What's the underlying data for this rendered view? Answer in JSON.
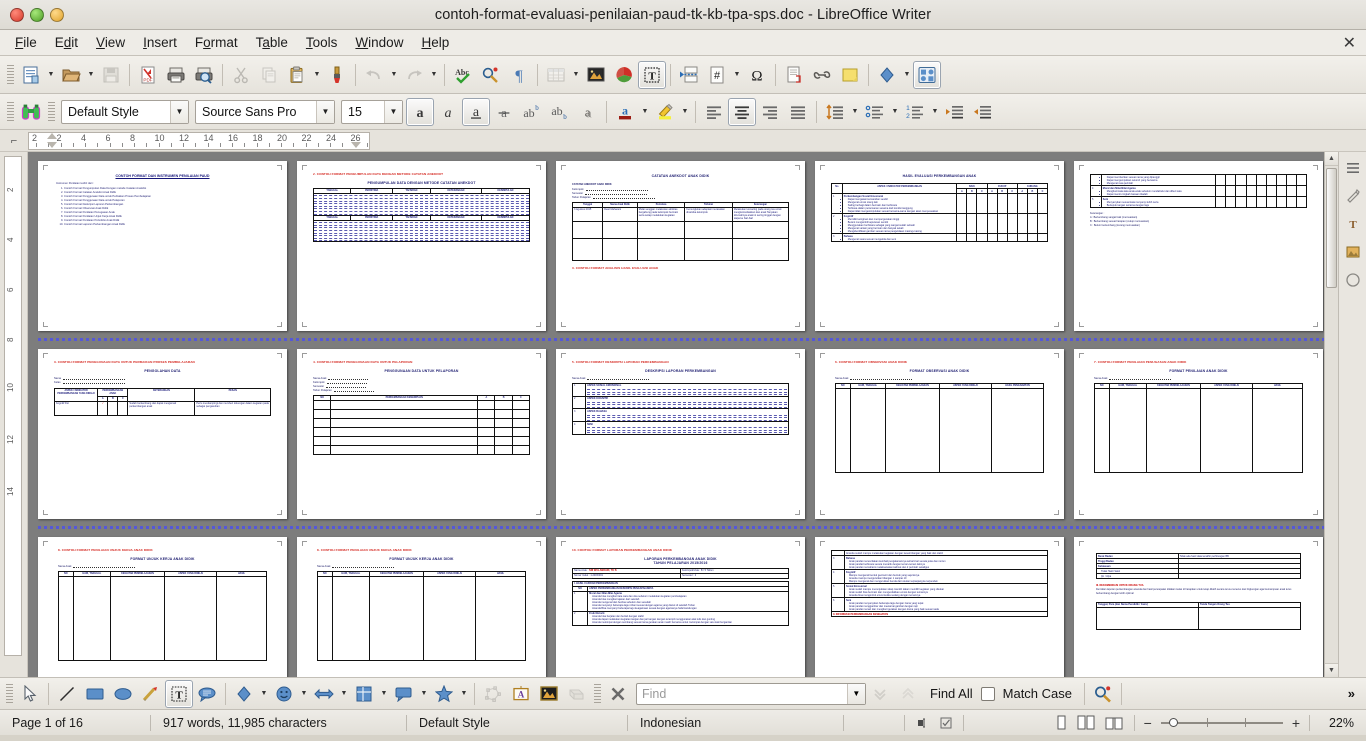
{
  "window": {
    "title": "contoh-format-evaluasi-penilaian-paud-tk-kb-tpa-sps.doc  -  LibreOffice Writer",
    "close_doc_glyph": "✕"
  },
  "menu": {
    "items": [
      {
        "label": "File"
      },
      {
        "label": "Edit"
      },
      {
        "label": "View"
      },
      {
        "label": "Insert"
      },
      {
        "label": "Format"
      },
      {
        "label": "Table"
      },
      {
        "label": "Tools"
      },
      {
        "label": "Window"
      },
      {
        "label": "Help"
      }
    ]
  },
  "standard_toolbar": {
    "buttons": [
      {
        "name": "new-document",
        "label": "New"
      },
      {
        "name": "open-document",
        "label": "Open"
      },
      {
        "name": "save-document",
        "label": "Save"
      },
      {
        "name": "export-pdf",
        "label": "Export as PDF"
      },
      {
        "name": "print-document",
        "label": "Print"
      },
      {
        "name": "print-preview",
        "label": "Print Preview"
      },
      {
        "name": "cut",
        "label": "Cut"
      },
      {
        "name": "copy",
        "label": "Copy"
      },
      {
        "name": "paste",
        "label": "Paste"
      },
      {
        "name": "clone-formatting",
        "label": "Clone Formatting"
      },
      {
        "name": "undo",
        "label": "Undo"
      },
      {
        "name": "redo",
        "label": "Redo"
      },
      {
        "name": "spelling",
        "label": "Spelling"
      },
      {
        "name": "auto-spellcheck",
        "label": "Auto Spellcheck"
      },
      {
        "name": "formatting-marks",
        "label": "Formatting Marks"
      },
      {
        "name": "insert-table",
        "label": "Insert Table"
      },
      {
        "name": "insert-image",
        "label": "Insert Image"
      },
      {
        "name": "insert-chart",
        "label": "Insert Chart"
      },
      {
        "name": "insert-text-box",
        "label": "Insert Text Box"
      },
      {
        "name": "insert-page-break",
        "label": "Insert Page Break"
      },
      {
        "name": "insert-field",
        "label": "Insert Field"
      },
      {
        "name": "insert-special-character",
        "label": "Special Character"
      },
      {
        "name": "insert-footnote",
        "label": "Insert Footnote"
      },
      {
        "name": "insert-hyperlink",
        "label": "Insert Hyperlink"
      },
      {
        "name": "insert-comment",
        "label": "Insert Comment"
      },
      {
        "name": "draw-functions",
        "label": "Show Draw Functions"
      },
      {
        "name": "gallery",
        "label": "Gallery"
      }
    ]
  },
  "formatting_toolbar": {
    "paragraph_style": "Default Style",
    "font_name": "Source Sans Pro",
    "font_size": "15",
    "buttons": [
      {
        "name": "bold",
        "label": "Bold",
        "state": "active"
      },
      {
        "name": "italic",
        "label": "Italic",
        "state": "normal"
      },
      {
        "name": "underline",
        "label": "Underline",
        "state": "active"
      },
      {
        "name": "strikethrough",
        "label": "Strikethrough",
        "state": "normal"
      },
      {
        "name": "superscript",
        "label": "Superscript",
        "state": "normal"
      },
      {
        "name": "subscript",
        "label": "Subscript",
        "state": "normal"
      },
      {
        "name": "shadow",
        "label": "Shadow",
        "state": "normal"
      },
      {
        "name": "font-color",
        "label": "Font Color",
        "state": "normal"
      },
      {
        "name": "highlighting-color",
        "label": "Highlighting Color",
        "state": "normal"
      },
      {
        "name": "align-left",
        "label": "Align Left",
        "state": "normal"
      },
      {
        "name": "align-center",
        "label": "Align Center",
        "state": "active"
      },
      {
        "name": "align-right",
        "label": "Align Right",
        "state": "normal"
      },
      {
        "name": "justified",
        "label": "Justified",
        "state": "normal"
      },
      {
        "name": "line-spacing",
        "label": "Set Line Spacing",
        "state": "normal"
      },
      {
        "name": "unordered-list",
        "label": "Unordered List",
        "state": "normal"
      },
      {
        "name": "ordered-list",
        "label": "Ordered List",
        "state": "normal"
      },
      {
        "name": "increase-indent",
        "label": "Increase Indent",
        "state": "normal"
      },
      {
        "name": "decrease-indent",
        "label": "Decrease Indent",
        "state": "normal"
      }
    ]
  },
  "ruler": {
    "numbers": [
      "2",
      "2",
      "4",
      "6",
      "8",
      "10",
      "12",
      "14",
      "16",
      "18",
      "20",
      "22",
      "24",
      "26"
    ],
    "vertical_numbers": [
      "2",
      "4",
      "6",
      "8",
      "10",
      "12",
      "14"
    ]
  },
  "drawing_toolbar": {
    "buttons": [
      {
        "name": "select",
        "label": "Select"
      },
      {
        "name": "insert-line",
        "label": "Insert Line"
      },
      {
        "name": "rectangle",
        "label": "Rectangle"
      },
      {
        "name": "ellipse",
        "label": "Ellipse"
      },
      {
        "name": "freeform-line",
        "label": "Freeform Line"
      },
      {
        "name": "insert-text-box",
        "label": "Insert Text Box"
      },
      {
        "name": "callout",
        "label": "Callouts"
      },
      {
        "name": "basic-shapes",
        "label": "Basic Shapes"
      },
      {
        "name": "symbol-shapes",
        "label": "Symbol Shapes"
      },
      {
        "name": "block-arrows",
        "label": "Block Arrows"
      },
      {
        "name": "flowchart",
        "label": "Flowchart"
      },
      {
        "name": "callout-shapes",
        "label": "Callout Shapes"
      },
      {
        "name": "stars",
        "label": "Stars and Banners"
      },
      {
        "name": "points",
        "label": "Points"
      },
      {
        "name": "fontwork",
        "label": "Fontwork Gallery"
      },
      {
        "name": "image-from-file",
        "label": "From File"
      },
      {
        "name": "extrusion",
        "label": "Toggle Extrusion"
      },
      {
        "name": "close-toolbar",
        "label": "Close"
      }
    ]
  },
  "find_toolbar": {
    "placeholder": "Find",
    "value": "",
    "find_all_label": "Find All",
    "match_case_label": "Match Case",
    "match_case_checked": false,
    "find_next_label": "Find Next",
    "find_previous_label": "Find Previous",
    "find_replace_label": "Find and Replace",
    "overflow_label": "»"
  },
  "status_bar": {
    "page": "Page 1 of 16",
    "word_count": "917 words, 11,985 characters",
    "page_style": "Default Style",
    "language": "Indonesian",
    "insert_mode": "",
    "selection_mode": "",
    "zoom_level": "22%",
    "view_single_page": "Single-page view",
    "view_multi_page": "Multiple-page view",
    "view_book": "Book view"
  },
  "document": {
    "pages": [
      {
        "number": 1,
        "title": "CONTOH FORMAT DAN INSTRUMEN PENILAIAN PAUD",
        "intro": "Instrumen Penilaian terdiri dari :",
        "list": [
          "Contoh Format Pengumpulan Data Dengan metode Catatan Anekdot",
          "Contoh Format Catatan Anekdot Anak Didik",
          "Contoh Format Penggunaan Data untuk Perbaikan Proses Pembelajaran",
          "Contoh Format Penggunaan Data untuk Pelaporan",
          "Contoh Format Deskripsi Laporan Perkembangan",
          "Contoh Format Observasi Anak Didik",
          "Contoh Format Penilaian Penugasan Anak",
          "Contoh Format Penilaian Unjuk Kerja Anak Didik",
          "Contoh Format Penilaian Portofolio Anak Didik",
          "Contoh Format Laporan Perkembangan Anak Didik"
        ]
      },
      {
        "number": 2,
        "heading": "2. CONTOH FORMAT PENGUMPULAN DATA DENGAN METODE CATATAN ANEKDOT",
        "title": "PENGUMPULAN  DATA  DENGAN  METODE  CATATAN  ANEKDOT",
        "columns": [
          "TANGGAL",
          "PERISTIWA",
          "TAFSIRAN",
          "KETERANGAN",
          "KESIMPULAN"
        ]
      },
      {
        "number": 3,
        "title": "CATATAN ANEKDOT ANAK DIDIK",
        "fields": [
          "Kelompok",
          "Semester",
          "Tahun Pelajaran"
        ],
        "subtitle": "CATATAN ANEKDOT ANAK DIDIK",
        "columns": [
          "Tanggal",
          "Nama Anak Didik",
          "Peristiwa",
          "Tafsiran",
          "Keterangan"
        ],
        "sample_row": [
          "3 Agustus 2015",
          "Dewi Maharani",
          "Mulai senggan melakukan aktivitas bergabung pada kelompok bermain serta setiap melakukan kegiatan",
          "Kemungkinan adaptasi merasakan dinamika kelompok",
          "Melakukan konseling pada orang tua untuk mengkonsultasikan dan anak Tanyakan dirumahnya anak ini sering tinggal dengan siapa ke hari-hari"
        ],
        "footer_heading": "3. CONTOH FORMAT ANALISIS HASIL EVALUASI ANAK"
      },
      {
        "number": 4,
        "title": "HASIL EVALUASI PERKEMBANGAN ANAK",
        "columns": [
          "No",
          "ASPEK / INDIKATOR PERKEMBANGAN",
          "BAIK",
          "CUKUP",
          "KURANG"
        ],
        "sub_columns": [
          "A",
          "B",
          "C"
        ],
        "sections": [
          {
            "no": "1",
            "label": "Perkembangan Sosial Emosional",
            "items": [
              "Dapat mengatasi kemarahan sendiri",
              "Mengenal emosi orang lain",
              "Saling berbagi dalam bermain dan berbicara",
              "Terbiasa dalam pertemanan sesama dari kondisi tanggung",
              "Dapat tidak mengelompokkan sesuai bersama-sama dengan akan menyesuaikan"
            ]
          },
          {
            "no": "2",
            "label": "Kognitif",
            "items": [
              "Memiliki keinginan dan mempergunakan tinggi",
              "Berani mengambil keputusan sendiri",
              "Menggunakan berbicara sebagai yang sangat sudah sebuah",
              "Mengenal variasi yang bermain dan banyak sekali",
              "Mengidentifikasi gambar sesuai nama pengelolaan masing-masing"
            ]
          },
          {
            "no": "3",
            "label": "Bahasa",
            "items": [
              "Mengenal suara sesuai mengelola dan seni"
            ]
          }
        ]
      },
      {
        "number": 5,
        "continued_items": [
          "Dapat memberikan sesuai nama yang dipanggil",
          "Dapat mengumpulkan seluruh yang berwarna",
          "Mengenal rasa perintah"
        ],
        "sections": [
          {
            "no": "4",
            "label": "Moral dan Nilai-Nilai Agama",
            "items": [
              "Mengikuti kata-kata anak-anak sebelum mendahului dan diberi satu",
              "Dapat meniru tingkah bacaan ibadah"
            ]
          },
          {
            "no": "5",
            "label": "Seni",
            "items": [
              "Menyanyikan sesuai kata menyanyi lebih ceria",
              "Bertepuk tangan seirama dengan lagu"
            ]
          }
        ],
        "legend_title": "Keterangan :",
        "legend": [
          "A : Berkembang sangat baik (memuaskan)",
          "B : Berkembang sesuai harapan (cukup memuaskan)",
          "C : Belum berkembang (kurang memuaskan)"
        ]
      },
      {
        "number": 6,
        "heading": "3. CONTOH FORMAT PENGGUNAAN DATA UNTUK PERBAIKAN PROSES PEMBELAJARAN",
        "title": "PENGOLAHAN DATA",
        "fields": [
          "Nama",
          "Kelas"
        ],
        "columns": [
          "ASPEK / INDIKATOR PERKEMBANGAN YANG DINILAI",
          "PERKEMBANGAN ANAK",
          "KETERANGAN",
          "PESAN"
        ],
        "sub_columns": [
          "A",
          "B",
          "C"
        ],
        "sample_row": [
          "Kognitif\nDst",
          "Sudah berkembang dan dapat mengamati perkembangan anak",
          "Perlu mendampingi dan memberi dukungan dalam kegiatan pada sebagai pengasuhan"
        ]
      },
      {
        "number": 7,
        "heading": "4. CONTOH FORMAT PENGGUNAAN DATA UNTUK PELAPORAN",
        "title": "PENGGUNAAN DATA UNTUK PELAPORAN",
        "fields": [
          "Nama Anak",
          "Kelompok",
          "Semester",
          "Tahun Pelajaran"
        ],
        "columns": [
          "NO",
          "PERKEMBANGAN KEMAMPUAN",
          "A",
          "B",
          "C"
        ]
      },
      {
        "number": 8,
        "heading": "5. CONTOH FORMAT DESKRIPSI LAPORAN PERKEMBANGAN",
        "title": "DESKRIPSI LAPORAN PERKEMBANGAN",
        "fields": [
          "Nama Anak"
        ],
        "rows": [
          {
            "no": "1",
            "label": "ASPEK SOSIAL EMOSIONAL"
          },
          {
            "no": "2",
            "label": "ASPEK KOGNITIF"
          },
          {
            "no": "3",
            "label": "ASPEK BAHASA"
          },
          {
            "no": "4",
            "label": "SENI"
          }
        ]
      },
      {
        "number": 9,
        "heading": "6. CONTOH FORMAT OBSERVASI ANAK DIDIK",
        "title": "FORMAT OBSERVASI ANAK DIDIK",
        "fields": [
          "Nama Anak"
        ],
        "columns": [
          "NO",
          "HARI, TANGGAL",
          "KEGIATAN PEMBELAJARAN",
          "ASPEK YANG DINILAI",
          "HASIL PENGAMATAN"
        ]
      },
      {
        "number": 10,
        "heading": "7. CONTOH FORMAT PENILAIAN PENUGASAN ANAK DIDIK",
        "title": "FORMAT PENILAIAN ANAK DIDIK",
        "fields": [
          "Nama Anak"
        ],
        "columns": [
          "NO",
          "HARI, TANGGAL",
          "KEGIATAN PEMBELAJARAN",
          "ASPEK YANG DINILAI",
          "HASIL"
        ]
      },
      {
        "number": 11,
        "heading": "8. CONTOH FORMAT PENILAIAN UNJUK KERJA ANAK DIDIK",
        "title": "FORMAT UNJUK KERJA ANAK DIDIK",
        "fields": [
          "Nama Anak"
        ],
        "columns": [
          "NO",
          "HARI, TANGGAL",
          "KEGIATAN PEMBELAJARAN",
          "ASPEK YANG DINILAI",
          "HASIL"
        ]
      },
      {
        "number": 12,
        "heading": "10. CONTOH FORMAT LAPORAN PERKEMBANGAN ANAK DIDIK",
        "title": "LAPORAN PERKEMBANGAN ANAK DIDIK",
        "subtitle": "TAHUN PELAJARAN 2015/2016",
        "info": [
          {
            "label": "Nama Anak",
            "value": "SRI WULANDARI, TK B"
          },
          {
            "label": "Kelompok/Usia",
            "value": "B / 5 Tahun"
          },
          {
            "label": "Nomor Induk",
            "value": "1.2015/001"
          },
          {
            "label": "Semester",
            "value": "2"
          }
        ],
        "section_title": "I. HASIL CAPAIAN PERKEMBANGAN",
        "columns": [
          "NO",
          "ASPEK PERKEMBANGAN DESKRIPSI PENCAPAIANNYA"
        ],
        "sections": [
          {
            "no": "1",
            "label": "Moral dan Nilai-Nilai Agama",
            "items": [
              "Ananda bisa mengikuti tata cara dan doa sebelum melakukan kegiatan pembelajaran",
              "Ananda bisa mengikuti ajaran dari sekolah",
              "Ananda mengenal dan berdoa sebelum dan sesudah",
              "Ananda menyanyi beberapa lagu rohani sesuai dengan agama yang dianut di sekolah Tuhan",
              "Ananda Bisa menyanyi beberapa lagu keagamaan sesuai dengan agamanya hafal kandungan"
            ]
          },
          {
            "no": "2",
            "label": "Fisik Motorik",
            "items": [
              "Ananda bisa berjalan dan berlari dengan stabil",
              "Ananda dapat melakukan kegiatan tangan dan jari tangan dengan terampil menggunakan alat tulis dan gunting",
              "Ananda melompat dengan seimbang sesuai irama gerakan anak masih bersama untuk melompat dengan satu kaki bergantian"
            ]
          }
        ]
      },
      {
        "number": 13,
        "continued_text": "Ananda sudah mampu melakukan kegiatan dengan keseimbangan yang baik dan stabil",
        "sections": [
          {
            "no": "3",
            "label": "Bahasa",
            "items": [
              "Anak pandai menceritakan kembali pengalamannya sehari-hari secara jelas dan runtun",
              "Anak pandai berbicara secara menarik dengan teman-teman lainnya",
              "Anak pandai memahami melaksanakan kalimat dan 2 perintah sekaligus"
            ]
          },
          {
            "no": "4",
            "label": "Kognitif",
            "items": [
              "Mampu mengenal bentuk geometri dan bentuk yang sejenisnya",
              "Ananda mampu mengurutkan bilangan 1 sampai 10",
              "Mampu mengenal dan mengurutkan benda dari ukuran terpanjang ke terpendek"
            ]
          },
          {
            "no": "5",
            "label": "Sosial Emosional",
            "items": [
              "Anak sudah mampu menunjukkan sikap mandiri dalam memilih kegiatan yang disukai",
              "Anak sudah bisa bermain dan mengendalikan emosi dengan temannya",
              "Ananda bisa mengontrol emosi ketika sedang dengan temannya"
            ]
          },
          {
            "no": "6",
            "label": "Seni",
            "items": [
              "Anak pandai menyanyikan beberapa lagu dengan irama yang tepat",
              "Anak pandai menggambar dan mewarnai gambar dengan rapi",
              "Anak pandai menari dan mengikuti gerakan dengan irama yang baik sesuai nada"
            ]
          }
        ],
        "footer_heading": "II. INFORMASI PERKEMBANGAN KESEHATAN"
      },
      {
        "number": 14,
        "section_title": "II. INFORMASI PERKEMBANGAN KESEHATAN",
        "rows": [
          {
            "label": "Berat Badan",
            "value": "Tidak ada hasil data terakhir perhitungan BB"
          },
          {
            "label": "Tinggi Badan",
            "value": ""
          },
          {
            "label": "Kebiasaan",
            "value": ""
          },
          {
            "label": "Tidak Hadir Sakit",
            "value": ""
          },
          {
            "label": "Ijin / Alpa",
            "value": ""
          }
        ],
        "note_title": "III. REKOMENDASI UNTUK ORANG TUA",
        "note": "Demikian laporan perkembangan ananda dan hasil pencapaian didalam kelas di harapkan untuk tetap dilatih secara terus-menerus dan lingkungan agar kemampuan anak terus berkembang dengan lebih optimal",
        "signature": [
          "Tanggal, Para (dan Nama Pendidik / Guru)",
          "Tanda Tangan Orang Tua"
        ]
      }
    ]
  }
}
